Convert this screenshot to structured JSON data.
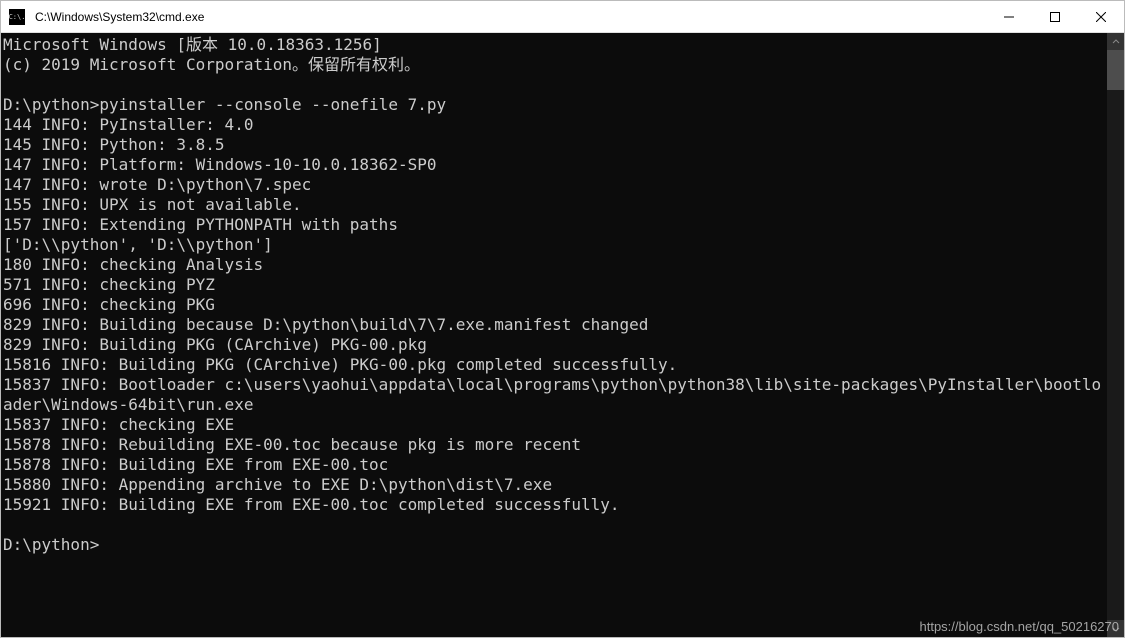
{
  "window": {
    "title": "C:\\Windows\\System32\\cmd.exe",
    "icon_text": "C:\\."
  },
  "terminal": {
    "lines": [
      "Microsoft Windows [版本 10.0.18363.1256]",
      "(c) 2019 Microsoft Corporation。保留所有权利。",
      "",
      "D:\\python>pyinstaller --console --onefile 7.py",
      "144 INFO: PyInstaller: 4.0",
      "145 INFO: Python: 3.8.5",
      "147 INFO: Platform: Windows-10-10.0.18362-SP0",
      "147 INFO: wrote D:\\python\\7.spec",
      "155 INFO: UPX is not available.",
      "157 INFO: Extending PYTHONPATH with paths",
      "['D:\\\\python', 'D:\\\\python']",
      "180 INFO: checking Analysis",
      "571 INFO: checking PYZ",
      "696 INFO: checking PKG",
      "829 INFO: Building because D:\\python\\build\\7\\7.exe.manifest changed",
      "829 INFO: Building PKG (CArchive) PKG-00.pkg",
      "15816 INFO: Building PKG (CArchive) PKG-00.pkg completed successfully.",
      "15837 INFO: Bootloader c:\\users\\yaohui\\appdata\\local\\programs\\python\\python38\\lib\\site-packages\\PyInstaller\\bootloader\\Windows-64bit\\run.exe",
      "15837 INFO: checking EXE",
      "15878 INFO: Rebuilding EXE-00.toc because pkg is more recent",
      "15878 INFO: Building EXE from EXE-00.toc",
      "15880 INFO: Appending archive to EXE D:\\python\\dist\\7.exe",
      "15921 INFO: Building EXE from EXE-00.toc completed successfully.",
      "",
      "D:\\python>"
    ]
  },
  "watermark": "https://blog.csdn.net/qq_50216270"
}
